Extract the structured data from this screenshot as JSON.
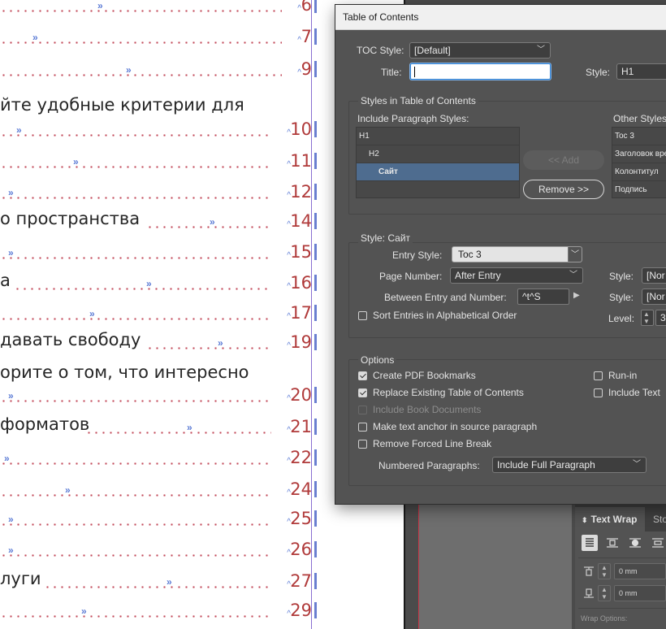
{
  "document": {
    "entries": [
      {
        "text": "",
        "page": "6"
      },
      {
        "text": "",
        "page": "7"
      },
      {
        "text": "",
        "page": "9"
      },
      {
        "text": "йте удобные критерии для",
        "page": ""
      },
      {
        "text": "",
        "page": "10"
      },
      {
        "text": "",
        "page": "11"
      },
      {
        "text": "",
        "page": "12"
      },
      {
        "text": "о пространства",
        "page": "14"
      },
      {
        "text": "",
        "page": "15"
      },
      {
        "text": "а",
        "page": "16"
      },
      {
        "text": "",
        "page": "17"
      },
      {
        "text": "давать свободу",
        "page": "19"
      },
      {
        "text": "орите о том, что интересно",
        "page": ""
      },
      {
        "text": "",
        "page": "20"
      },
      {
        "text": "форматов",
        "page": "21"
      },
      {
        "text": "",
        "page": "22"
      },
      {
        "text": "",
        "page": "24"
      },
      {
        "text": "",
        "page": "25"
      },
      {
        "text": "",
        "page": "26"
      },
      {
        "text": "луги",
        "page": "27"
      },
      {
        "text": "",
        "page": "29"
      }
    ]
  },
  "dialog": {
    "title": "Table of Contents",
    "toc_style_label": "TOC Style:",
    "toc_style_value": "[Default]",
    "title_label": "Title:",
    "title_value": "",
    "title_style_label": "Style:",
    "title_style_value": "H1",
    "styles_group_title": "Styles in Table of Contents",
    "include_label": "Include Paragraph Styles:",
    "include_items": [
      "H1",
      "H2",
      "Сайт"
    ],
    "other_label": "Other Styles",
    "other_items": [
      "Toc 3",
      "Заголовок вре",
      "Колонтитул",
      "Подпись"
    ],
    "add_button": "<< Add",
    "remove_button": "Remove >>",
    "style_group_title": "Style: Сайт",
    "entry_style_label": "Entry Style:",
    "entry_style_value": "Toc 3",
    "page_number_label": "Page Number:",
    "page_number_value": "After Entry",
    "page_number_style_label": "Style:",
    "page_number_style_value": "[Nor",
    "between_label": "Between Entry and Number:",
    "between_value": "^t^S",
    "between_style_label": "Style:",
    "between_style_value": "[Nor",
    "sort_label": "Sort Entries in Alphabetical Order",
    "level_label": "Level:",
    "level_value": "3",
    "options_group_title": "Options",
    "options": {
      "create_pdf_bookmarks": "Create PDF Bookmarks",
      "replace_existing": "Replace Existing Table of Contents",
      "include_book": "Include Book Documents",
      "make_anchor": "Make text anchor in source paragraph",
      "remove_forced": "Remove Forced Line Break",
      "run_in": "Run-in",
      "include_text": "Include Text"
    },
    "numbered_label": "Numbered Paragraphs:",
    "numbered_value": "Include Full Paragraph"
  },
  "text_wrap_panel": {
    "tab_active": "Text Wrap",
    "tab_other": "Sto",
    "top_offset": "0 mm",
    "bottom_offset": "0 mm",
    "wrap_options_label": "Wrap Options:"
  }
}
